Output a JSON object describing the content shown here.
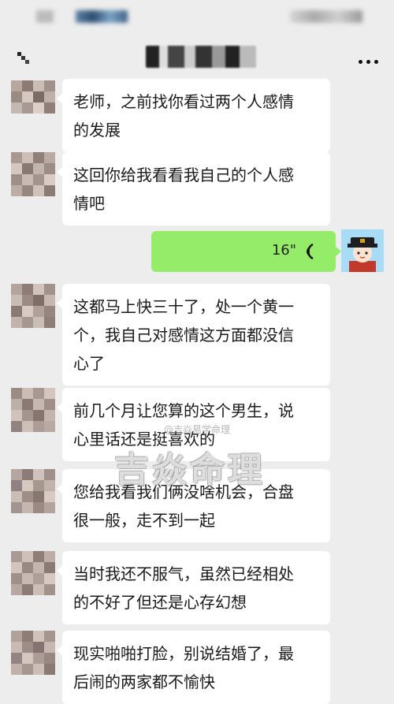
{
  "nav": {
    "title": "",
    "more_label": "···"
  },
  "messages": [
    {
      "side": "left",
      "lines": [
        "老师，之前找你看过两个人感情",
        "的发展"
      ]
    },
    {
      "side": "left",
      "lines": [
        "这回你给我看看我自己的个人感",
        "情吧"
      ]
    },
    {
      "side": "right",
      "type": "voice",
      "duration": "16\""
    },
    {
      "side": "left",
      "lines": [
        "这都马上快三十了，处一个黄一",
        "个，我自己对感情这方面都没信",
        "心了"
      ]
    },
    {
      "side": "left",
      "lines": [
        "前几个月让您算的这个男生，说",
        "心里话还是挺喜欢的"
      ]
    },
    {
      "side": "left",
      "lines": [
        "您给我看我们俩没啥机会，合盘",
        "很一般，走不到一起"
      ]
    },
    {
      "side": "left",
      "lines": [
        "当时我还不服气，虽然已经相处",
        "的不好了但还是心存幻想"
      ]
    },
    {
      "side": "left",
      "lines": [
        "现实啪啪打脸，别说结婚了，最",
        "后闹的两家都不愉快"
      ]
    }
  ],
  "watermark": {
    "small": "@吉焱易学命理",
    "big": "吉焱命理"
  },
  "colors": {
    "background": "#ededed",
    "bubble_left": "#ffffff",
    "bubble_right": "#95ec69"
  }
}
